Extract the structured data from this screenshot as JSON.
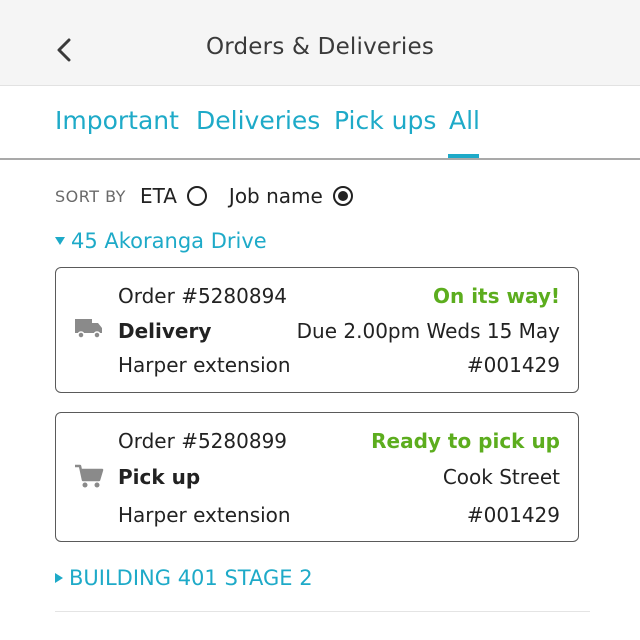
{
  "header": {
    "title": "Orders & Deliveries"
  },
  "tabs": [
    {
      "label": "Important"
    },
    {
      "label": "Deliveries"
    },
    {
      "label": "Pick ups"
    },
    {
      "label": "All"
    }
  ],
  "active_tab": "All",
  "sort": {
    "label": "SORT BY",
    "options": [
      {
        "label": "ETA",
        "selected": false
      },
      {
        "label": "Job name",
        "selected": true
      }
    ]
  },
  "groups": [
    {
      "name": "45 Akoranga Drive",
      "expanded": true,
      "orders": [
        {
          "icon": "truck-icon",
          "order_number": "Order #5280894",
          "status": "On its way!",
          "type": "Delivery",
          "detail": "Due 2.00pm Weds 15 May",
          "job": "Harper extension",
          "job_number": "#001429"
        },
        {
          "icon": "cart-icon",
          "order_number": "Order #5280899",
          "status": "Ready to pick up",
          "type": "Pick up",
          "detail": "Cook Street",
          "job": "Harper extension",
          "job_number": "#001429"
        }
      ]
    },
    {
      "name": "BUILDING 401 STAGE 2",
      "expanded": false
    }
  ],
  "colors": {
    "accent": "#1eaac8",
    "status_green": "#5cad1e",
    "header_bg": "#f5f5f5"
  }
}
